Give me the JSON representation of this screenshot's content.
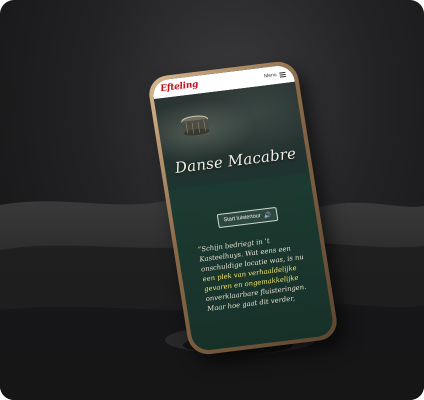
{
  "header": {
    "logo_text": "Efteling",
    "menu_label": "Menu",
    "menu_icon": "hamburger-icon"
  },
  "hero": {
    "title": "Danse Macabre",
    "image_icon": "well-icon"
  },
  "audio_button": {
    "label": "Start luistertour",
    "icon": "speaker-icon"
  },
  "story": {
    "lines": [
      "“Schijn bedriegt in ’t",
      "Kasteelhuys. Wat eens een",
      "onschuldige locatie was, is nu",
      "een plek van verhaaldelijke",
      "gevaren en ongemakkelijke",
      "onverklaarbare fluisteringen.",
      "Maar hoe gaat dit verder,"
    ]
  },
  "colors": {
    "brand_red": "#c4121a",
    "screen_green": "#1c3a31",
    "highlight_yellow": "#f2e66b",
    "frame_gold": "#b8946a"
  }
}
